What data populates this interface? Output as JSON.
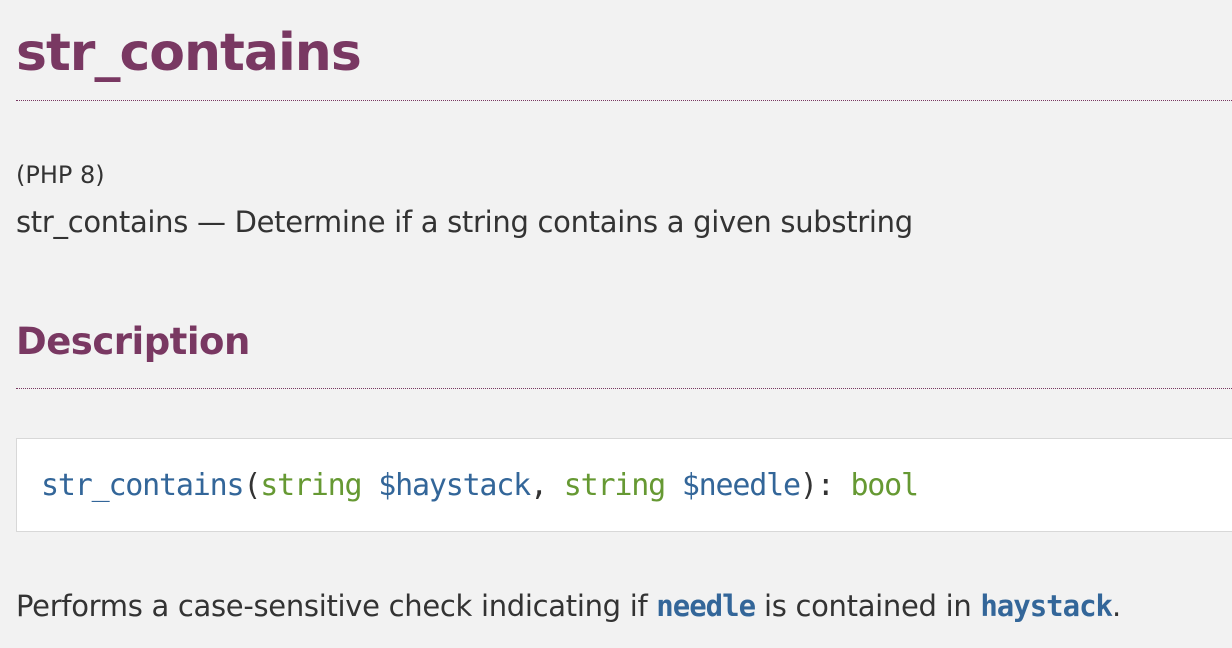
{
  "refname": {
    "title": "str_contains"
  },
  "refnamediv": {
    "version": "(PHP 8)",
    "purpose_name": "str_contains",
    "purpose_dash": " — ",
    "purpose_text": "Determine if a string contains a given substring"
  },
  "description": {
    "heading": "Description",
    "synopsis": {
      "method_name": "str_contains",
      "open_paren": "(",
      "param1_type": "string",
      "param1_var": "$haystack",
      "separator": ", ",
      "param2_type": "string",
      "param2_var": "$needle",
      "close_paren": "): ",
      "return_type": "bool"
    },
    "paragraph": {
      "text_before": "Performs a case-sensitive check indicating if ",
      "param_needle": "needle",
      "text_middle": " is contained in ",
      "param_haystack": "haystack",
      "text_after": "."
    }
  },
  "colors": {
    "heading": "#793862",
    "method": "#336699",
    "type": "#669933",
    "background": "#f2f2f2",
    "synopsis_bg": "#ffffff"
  }
}
